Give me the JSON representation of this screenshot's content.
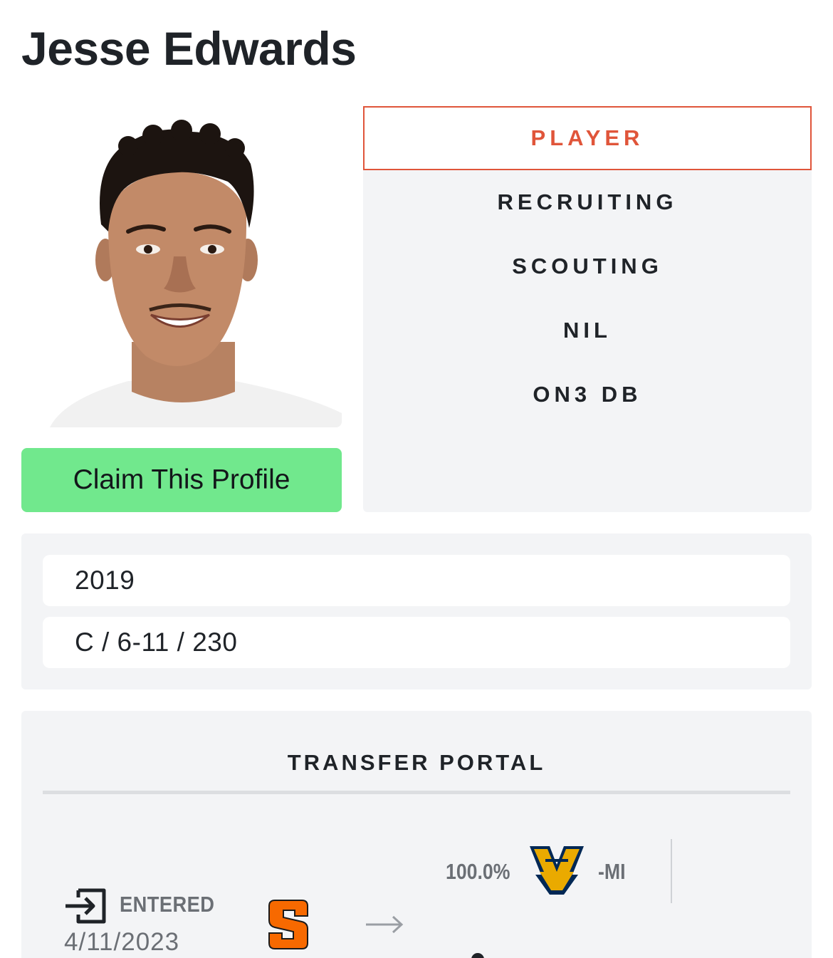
{
  "player": {
    "name": "Jesse Edwards",
    "claim_label": "Claim This Profile"
  },
  "tabs": [
    {
      "label": "PLAYER",
      "active": true
    },
    {
      "label": "RECRUITING",
      "active": false
    },
    {
      "label": "SCOUTING",
      "active": false
    },
    {
      "label": "NIL",
      "active": false
    },
    {
      "label": "ON3 DB",
      "active": false
    }
  ],
  "info": {
    "class_year": "2019",
    "position_height_weight": "C / 6-11 / 230"
  },
  "transfer_portal": {
    "title": "TRANSFER PORTAL",
    "status": "ENTERED",
    "date": "4/11/2023",
    "from_school_icon": "syracuse-logo",
    "prediction_percent": "100.0%",
    "to_school_icon": "west-virginia-logo",
    "prediction_suffix": "-MI"
  },
  "colors": {
    "accent": "#e0553a",
    "claim_button": "#71e88d",
    "panel_bg": "#f3f4f6",
    "syracuse_orange": "#f76900",
    "wvu_gold": "#eaaa00",
    "wvu_navy": "#002855"
  }
}
